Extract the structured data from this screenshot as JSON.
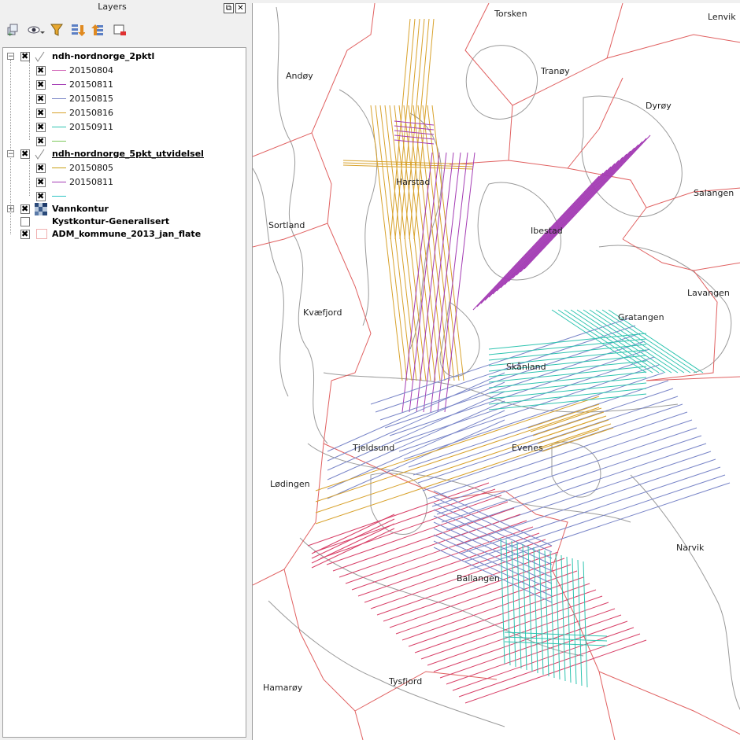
{
  "panel": {
    "title": "Layers",
    "restore_glyph": "⧉",
    "close_glyph": "✕",
    "toolbar_icons": [
      "add-group-icon",
      "visibility-icon",
      "filter-icon",
      "expand-all-icon",
      "collapse-all-icon",
      "remove-layer-icon"
    ]
  },
  "layers": {
    "group1": {
      "name": "ndh-nordnorge_2pktl",
      "expander": "−",
      "checked": true,
      "items": [
        {
          "label": "20150804",
          "color": "#d268b8",
          "checked": true
        },
        {
          "label": "20150811",
          "color": "#a43cb4",
          "checked": true
        },
        {
          "label": "20150815",
          "color": "#7a86c8",
          "checked": true
        },
        {
          "label": "20150816",
          "color": "#d8a22c",
          "checked": true
        },
        {
          "label": "20150911",
          "color": "#2ec4b0",
          "checked": true
        },
        {
          "label": "",
          "color": "#7cc85a",
          "checked": true
        }
      ]
    },
    "group2": {
      "name": "ndh-nordnorge_5pkt_utvidelsel",
      "expander": "−",
      "checked": true,
      "items": [
        {
          "label": "20150805",
          "color": "#c8a014",
          "checked": true
        },
        {
          "label": "20150811",
          "color": "#a43cb4",
          "checked": true
        },
        {
          "label": "",
          "color": "#2ec4c4",
          "checked": true
        }
      ]
    },
    "vannkontur": {
      "name": "Vannkontur",
      "expander": "+",
      "checked": true
    },
    "kystkontur": {
      "name": "Kystkontur-Generalisert",
      "checked": false
    },
    "adm": {
      "name": "ADM_kommune_2013_jan_flate",
      "checked": true
    }
  },
  "map": {
    "places": [
      "Torsken",
      "Lenvik",
      "Andøy",
      "Tranøy",
      "Dyrøy",
      "Harstad",
      "Salangen",
      "Sortland",
      "Ibestad",
      "Lavangen",
      "Kvæfjord",
      "Gratangen",
      "Skånland",
      "Tjeldsund",
      "Evenes",
      "Lødingen",
      "Narvik",
      "Ballangen",
      "Tysfjord",
      "Hamarøy"
    ],
    "colors": {
      "boundary": "#e06060",
      "coast": "#9a9a9a",
      "pink": "#d84068",
      "purple": "#a43cb4",
      "blue": "#7a86c8",
      "orange": "#d8a22c",
      "teal": "#2ec4b0"
    }
  }
}
